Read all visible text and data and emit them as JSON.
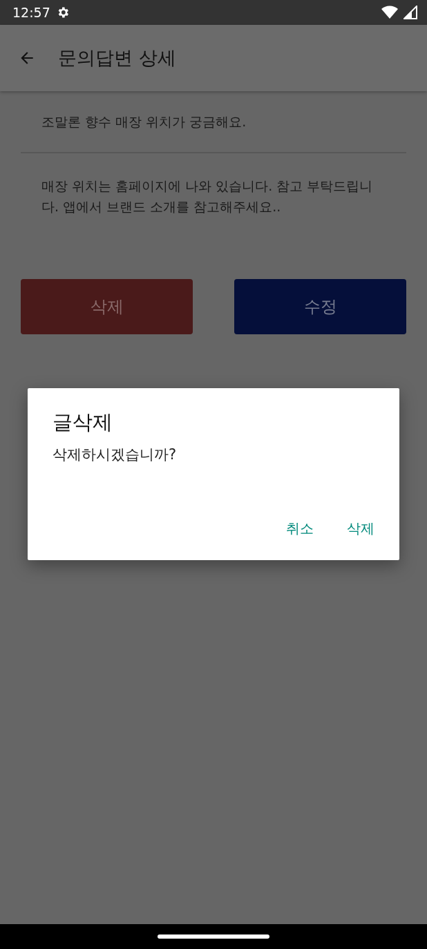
{
  "status_bar": {
    "time": "12:57"
  },
  "app_bar": {
    "title": "문의답변 상세"
  },
  "question": "조말론 향수 매장 위치가 궁금해요.",
  "answer": "매장 위치는 홈페이지에 나와 있습니다. 참고 부탁드립니다. 앱에서 브랜드 소개를 참고해주세요..",
  "buttons": [
    {
      "label": "삭제",
      "kind": "delete"
    },
    {
      "label": "수정",
      "kind": "edit"
    }
  ],
  "dialog": {
    "title": "글삭제",
    "message": "삭제하시겠습니까?",
    "actions": [
      "취소",
      "삭제"
    ]
  }
}
